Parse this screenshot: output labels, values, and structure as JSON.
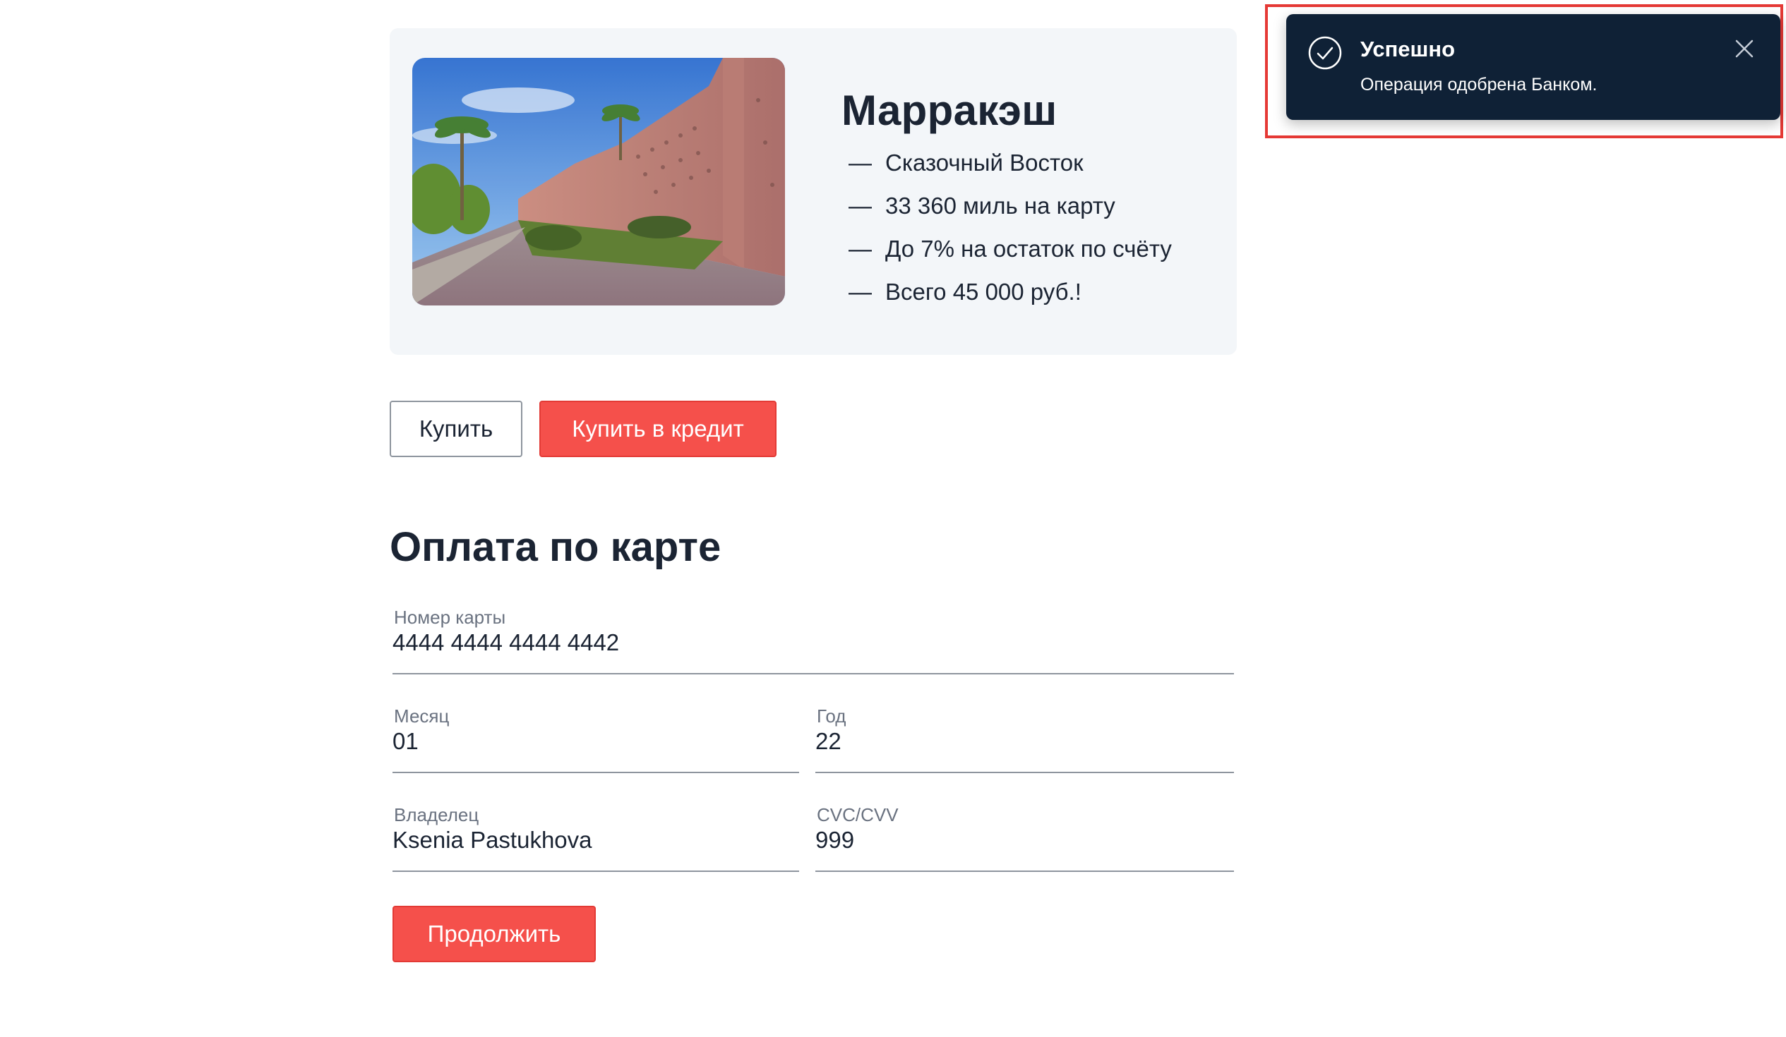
{
  "offer": {
    "title": "Марракэш",
    "image_alt": "marrakech-city-wall-photo",
    "features": [
      {
        "dash": "—",
        "text": "Сказочный Восток"
      },
      {
        "dash": "—",
        "text": "33 360 миль на карту"
      },
      {
        "dash": "—",
        "text": "До 7% на остаток по счёту"
      },
      {
        "dash": "—",
        "text": "Всего 45 000 руб.!"
      }
    ]
  },
  "actions": {
    "buy_label": "Купить",
    "buy_credit_label": "Купить в кредит"
  },
  "payment": {
    "title": "Оплата по карте",
    "card_number": {
      "label": "Номер карты",
      "value": "4444 4444 4444 4442"
    },
    "month": {
      "label": "Месяц",
      "value": "01"
    },
    "year": {
      "label": "Год",
      "value": "22"
    },
    "owner": {
      "label": "Владелец",
      "value": "Ksenia Pastukhova"
    },
    "cvc": {
      "label": "CVC/CVV",
      "value": "999"
    },
    "continue_label": "Продолжить"
  },
  "notification": {
    "icon": "check-circle-icon",
    "title": "Успешно",
    "text": "Операция одобрена Банком.",
    "close_icon": "close-icon"
  },
  "colors": {
    "accent_red": "#f5504b",
    "toast_bg": "#0f2136",
    "card_bg": "#f3f6f9",
    "text_dark": "#1b2433",
    "highlight_border": "#e53935"
  }
}
